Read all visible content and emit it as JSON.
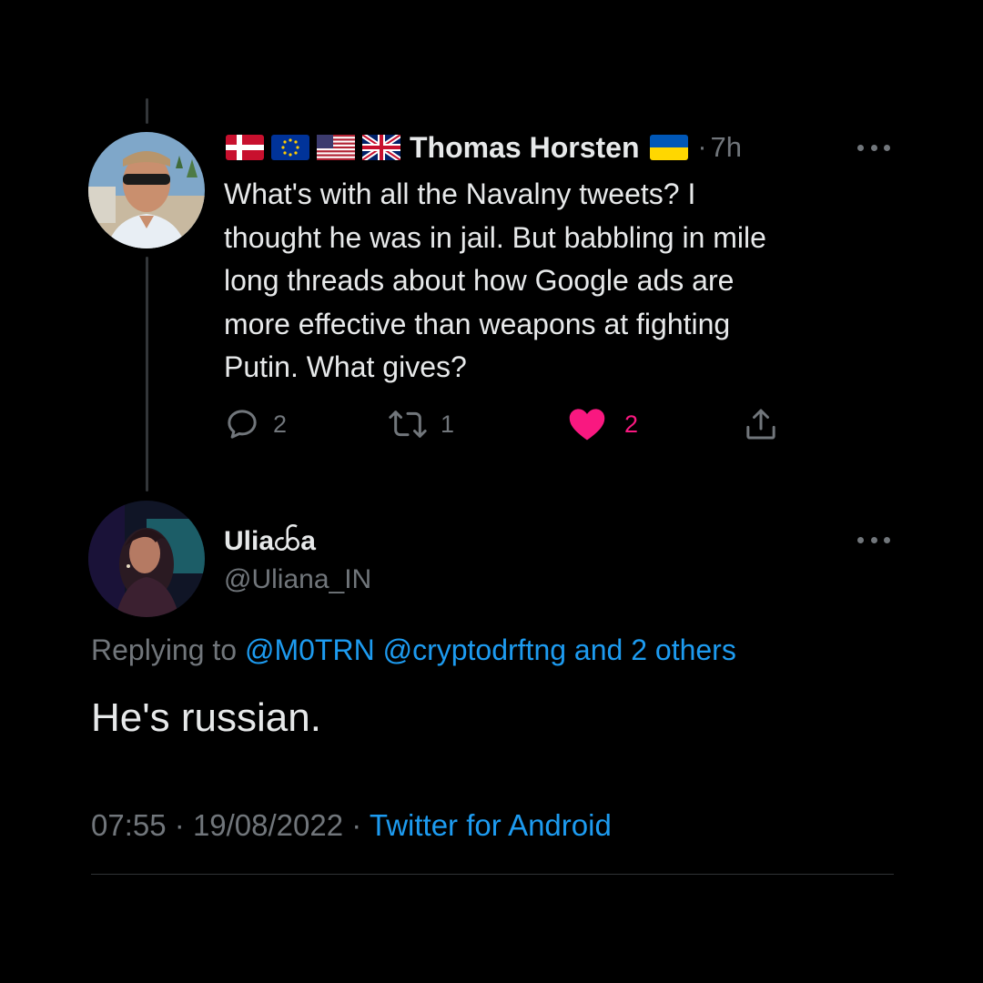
{
  "original_tweet": {
    "author": {
      "name": "Thomas Horsten",
      "flags_before_name": [
        "denmark-flag-icon",
        "eu-flag-icon",
        "usa-flag-icon",
        "uk-flag-icon"
      ],
      "flag_after_name": "ukraine-flag-icon"
    },
    "separator": "·",
    "time_ago": "7h",
    "text": "What's with all the Navalny tweets? I\nthought he was in jail. But babbling in mile\nlong threads about how Google ads are\nmore effective than weapons at fighting\nPutin. What gives?",
    "actions": {
      "reply_count": "2",
      "retweet_count": "1",
      "like_count": "2",
      "liked": true
    }
  },
  "reply_tweet": {
    "author": {
      "name": "Uliaꧤa",
      "handle": "@Uliana_IN"
    },
    "replying_to_prefix": "Replying to",
    "replying_to_links": "@M0TRN @cryptodrftng and 2 others",
    "text": "He's russian.",
    "time": "07:55",
    "separator": "·",
    "date": "19/08/2022",
    "source": "Twitter for Android"
  },
  "colors": {
    "background": "#000000",
    "text_primary": "#e7e9ea",
    "text_secondary": "#71767b",
    "accent_link": "#1d9bf0",
    "like": "#f91880",
    "divider": "#2f3336"
  }
}
